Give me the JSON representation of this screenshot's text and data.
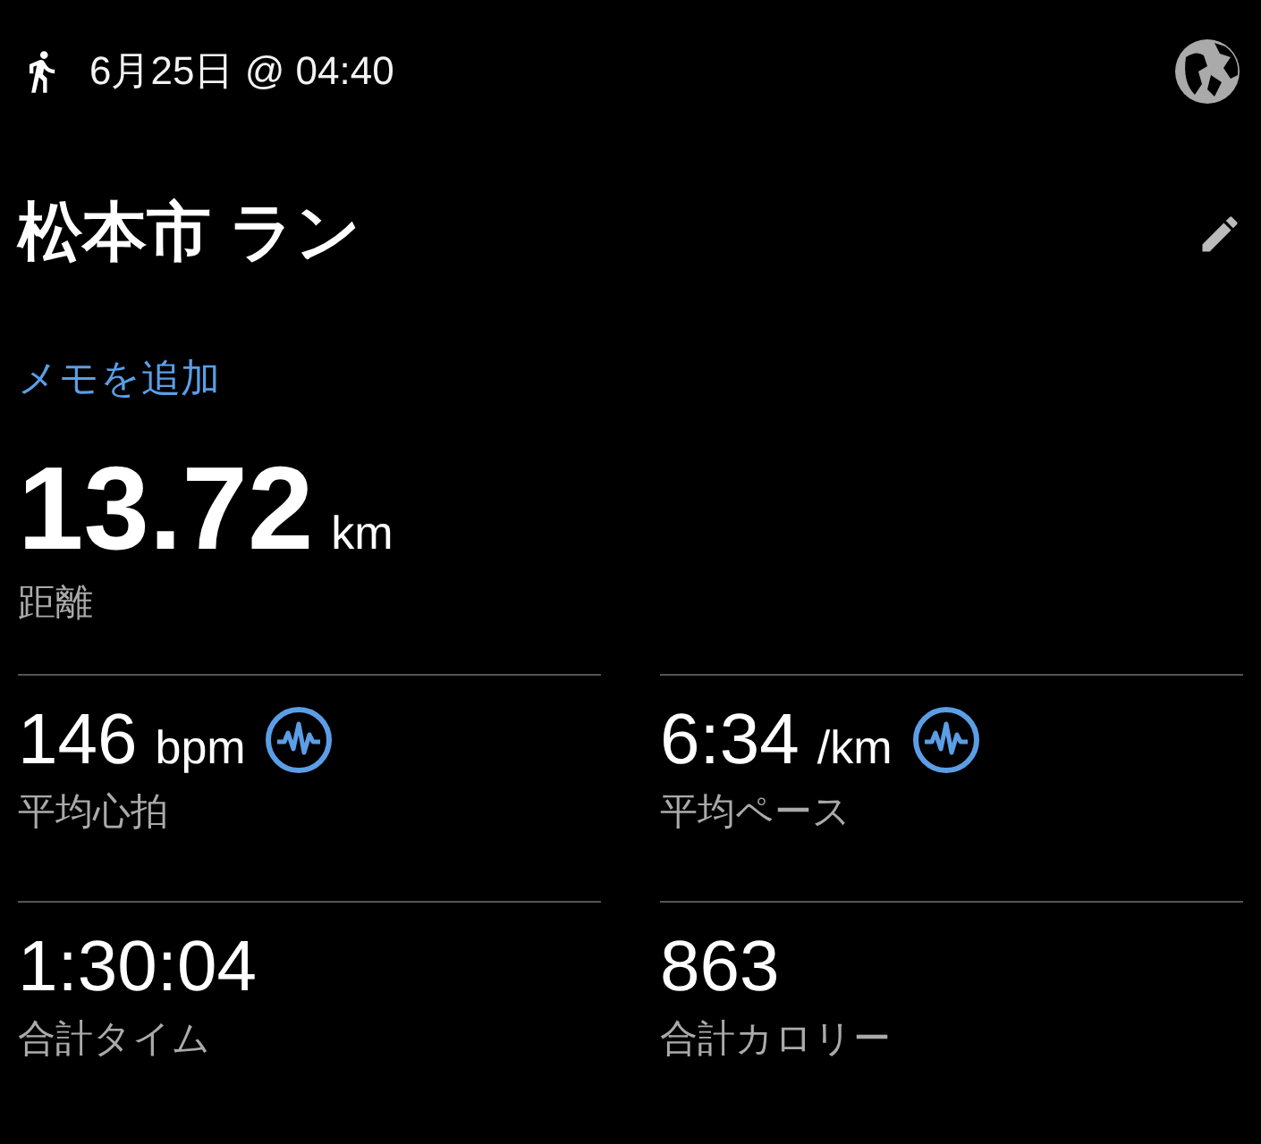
{
  "header": {
    "datetime": "6月25日 @ 04:40"
  },
  "title": "松本市 ラン",
  "memo_link": "メモを追加",
  "distance": {
    "value": "13.72",
    "unit": "km",
    "label": "距離"
  },
  "stats": [
    {
      "value": "146",
      "unit": "bpm",
      "label": "平均心拍",
      "chart_icon": true
    },
    {
      "value": "6:34",
      "unit": "/km",
      "label": "平均ペース",
      "chart_icon": true
    },
    {
      "value": "1:30:04",
      "label": "合計タイム",
      "chart_icon": false
    },
    {
      "value": "863",
      "label": "合計カロリー",
      "chart_icon": false
    }
  ]
}
